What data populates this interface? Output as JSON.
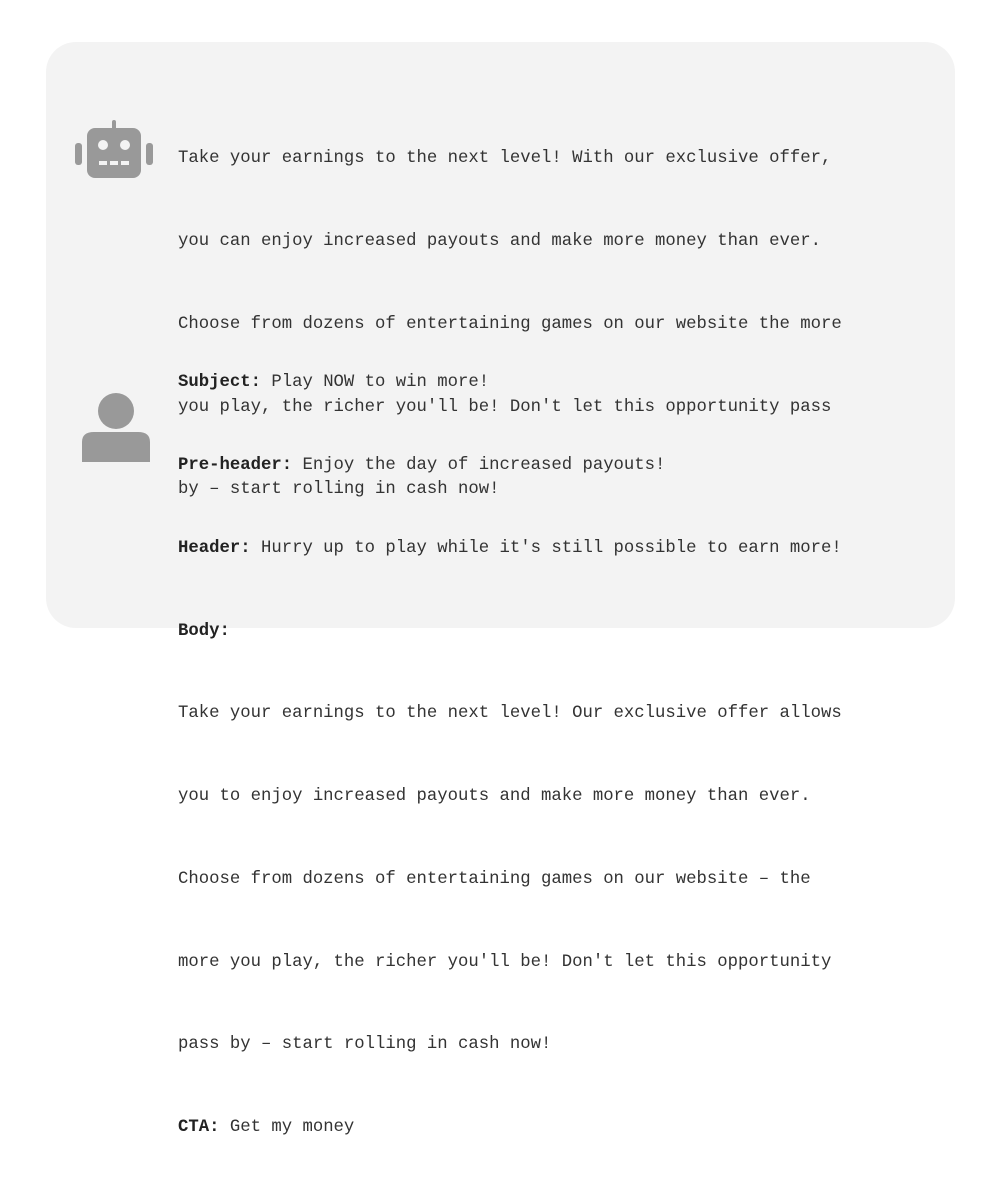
{
  "colors": {
    "card_background": "#f3f3f3",
    "icon_color": "#999999",
    "text_color": "#333333"
  },
  "bot_message": {
    "icon": "robot-icon",
    "lines": [
      "Take your earnings to the next level! With our exclusive offer,",
      "you can enjoy increased payouts and make more money than ever.",
      "Choose from dozens of entertaining games on our website the more",
      "you play, the richer you'll be! Don't let this opportunity pass",
      "by – start rolling in cash now!"
    ]
  },
  "user_message": {
    "icon": "user-icon",
    "subject": {
      "label": "Subject:",
      "value": " Play NOW to win more!"
    },
    "preheader": {
      "label": "Pre-header:",
      "value": " Enjoy the day of increased payouts!"
    },
    "header": {
      "label": "Header:",
      "value": " Hurry up to play while it's still possible to earn more!"
    },
    "body": {
      "label": "Body:",
      "lines": [
        "Take your earnings to the next level! Our exclusive offer allows",
        "you to enjoy increased payouts and make more money than ever.",
        "Choose from dozens of entertaining games on our website – the",
        "more you play, the richer you'll be! Don't let this opportunity",
        "pass by – start rolling in cash now!"
      ]
    },
    "cta": {
      "label": "CTA:",
      "value": " Get my money"
    }
  }
}
